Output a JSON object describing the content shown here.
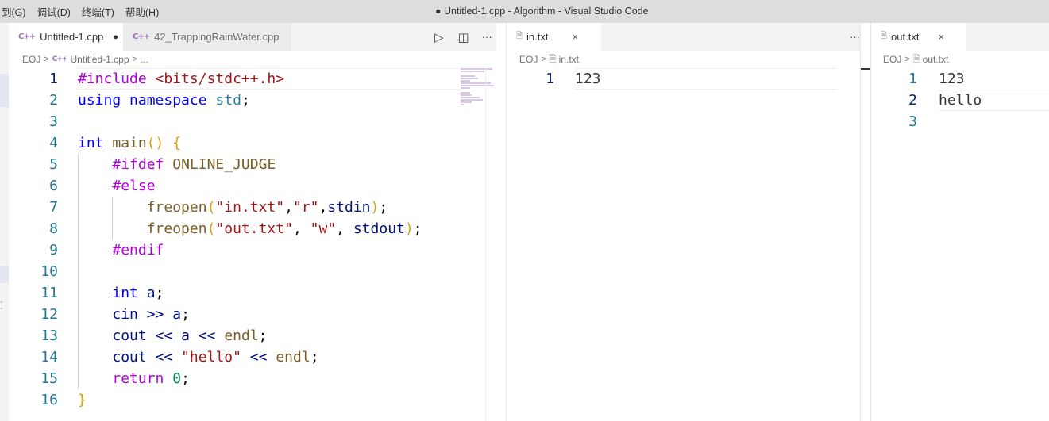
{
  "window": {
    "title": "● Untitled-1.cpp - Algorithm - Visual Studio Code",
    "menu": [
      "到(G)",
      "调试(D)",
      "终端(T)",
      "帮助(H)"
    ]
  },
  "groups": [
    {
      "tabs": [
        {
          "icon": "C++",
          "label": "Untitled-1.cpp",
          "modified": "●",
          "active": true
        },
        {
          "icon": "C++",
          "label": "42_TrappingRainWater.cpp",
          "active": false
        }
      ],
      "actions": {
        "run": "▷",
        "split": "◫",
        "more": "···"
      },
      "breadcrumb": [
        "EOJ",
        "Untitled-1.cpp",
        "..."
      ],
      "current_line": 1
    },
    {
      "tabs": [
        {
          "icon": "file",
          "label": "in.txt",
          "close": "×",
          "active": true
        }
      ],
      "actions": {
        "more": "···"
      },
      "breadcrumb": [
        "EOJ",
        "in.txt"
      ],
      "lines": [
        "123"
      ],
      "current_line": 1
    },
    {
      "tabs": [
        {
          "icon": "file",
          "label": "out.txt",
          "close": "×",
          "active": true
        }
      ],
      "breadcrumb": [
        "EOJ",
        "out.txt"
      ],
      "lines": [
        "123",
        "hello",
        ""
      ],
      "current_line": 2
    }
  ],
  "code_lines": [
    [
      [
        "k-pre",
        "#include"
      ],
      [
        "k-op",
        " "
      ],
      [
        "k-str",
        "<bits/stdc++.h>"
      ]
    ],
    [
      [
        "k-kw",
        "using"
      ],
      [
        "k-op",
        " "
      ],
      [
        "k-kw",
        "namespace"
      ],
      [
        "k-op",
        " "
      ],
      [
        "k-type",
        "std"
      ],
      [
        "k-op",
        ";"
      ]
    ],
    [],
    [
      [
        "k-kw",
        "int"
      ],
      [
        "k-op",
        " "
      ],
      [
        "k-fn",
        "main"
      ],
      [
        "k-brace",
        "()"
      ],
      [
        "k-op",
        " "
      ],
      [
        "k-brace",
        "{"
      ]
    ],
    [
      [
        "k-op",
        "    "
      ],
      [
        "k-pre",
        "#ifdef"
      ],
      [
        "k-op",
        " "
      ],
      [
        "k-fn",
        "ONLINE_JUDGE"
      ]
    ],
    [
      [
        "k-op",
        "    "
      ],
      [
        "k-pre",
        "#else"
      ]
    ],
    [
      [
        "k-op",
        "        "
      ],
      [
        "k-fn",
        "freopen"
      ],
      [
        "k-brace",
        "("
      ],
      [
        "k-str",
        "\"in.txt\""
      ],
      [
        "k-op",
        ","
      ],
      [
        "k-str",
        "\"r\""
      ],
      [
        "k-op",
        ","
      ],
      [
        "k-id",
        "stdin"
      ],
      [
        "k-brace",
        ")"
      ],
      [
        "k-op",
        ";"
      ]
    ],
    [
      [
        "k-op",
        "        "
      ],
      [
        "k-fn",
        "freopen"
      ],
      [
        "k-brace",
        "("
      ],
      [
        "k-str",
        "\"out.txt\""
      ],
      [
        "k-op",
        ", "
      ],
      [
        "k-str",
        "\"w\""
      ],
      [
        "k-op",
        ", "
      ],
      [
        "k-id",
        "stdout"
      ],
      [
        "k-brace",
        ")"
      ],
      [
        "k-op",
        ";"
      ]
    ],
    [
      [
        "k-op",
        "    "
      ],
      [
        "k-pre",
        "#endif"
      ]
    ],
    [],
    [
      [
        "k-op",
        "    "
      ],
      [
        "k-kw",
        "int"
      ],
      [
        "k-op",
        " "
      ],
      [
        "k-id",
        "a"
      ],
      [
        "k-op",
        ";"
      ]
    ],
    [
      [
        "k-op",
        "    "
      ],
      [
        "k-id",
        "cin"
      ],
      [
        "k-op",
        " "
      ],
      [
        "k-id",
        ">>"
      ],
      [
        "k-op",
        " "
      ],
      [
        "k-id",
        "a"
      ],
      [
        "k-op",
        ";"
      ]
    ],
    [
      [
        "k-op",
        "    "
      ],
      [
        "k-id",
        "cout"
      ],
      [
        "k-op",
        " "
      ],
      [
        "k-id",
        "<<"
      ],
      [
        "k-op",
        " "
      ],
      [
        "k-id",
        "a"
      ],
      [
        "k-op",
        " "
      ],
      [
        "k-id",
        "<<"
      ],
      [
        "k-op",
        " "
      ],
      [
        "k-fn",
        "endl"
      ],
      [
        "k-op",
        ";"
      ]
    ],
    [
      [
        "k-op",
        "    "
      ],
      [
        "k-id",
        "cout"
      ],
      [
        "k-op",
        " "
      ],
      [
        "k-id",
        "<<"
      ],
      [
        "k-op",
        " "
      ],
      [
        "k-str",
        "\"hello\""
      ],
      [
        "k-op",
        " "
      ],
      [
        "k-id",
        "<<"
      ],
      [
        "k-op",
        " "
      ],
      [
        "k-fn",
        "endl"
      ],
      [
        "k-op",
        ";"
      ]
    ],
    [
      [
        "k-op",
        "    "
      ],
      [
        "k-ret",
        "return"
      ],
      [
        "k-op",
        " "
      ],
      [
        "k-num",
        "0"
      ],
      [
        "k-op",
        ";"
      ]
    ],
    [
      [
        "k-brace",
        "}"
      ]
    ]
  ],
  "colors": {
    "keyword": "#0000ff",
    "preprocessor": "#af00db",
    "string": "#a31515",
    "type": "#267f99",
    "identifier": "#001080",
    "function": "#795e26",
    "number": "#098658",
    "brace": "#d7a20f",
    "line_number": "#237893"
  }
}
